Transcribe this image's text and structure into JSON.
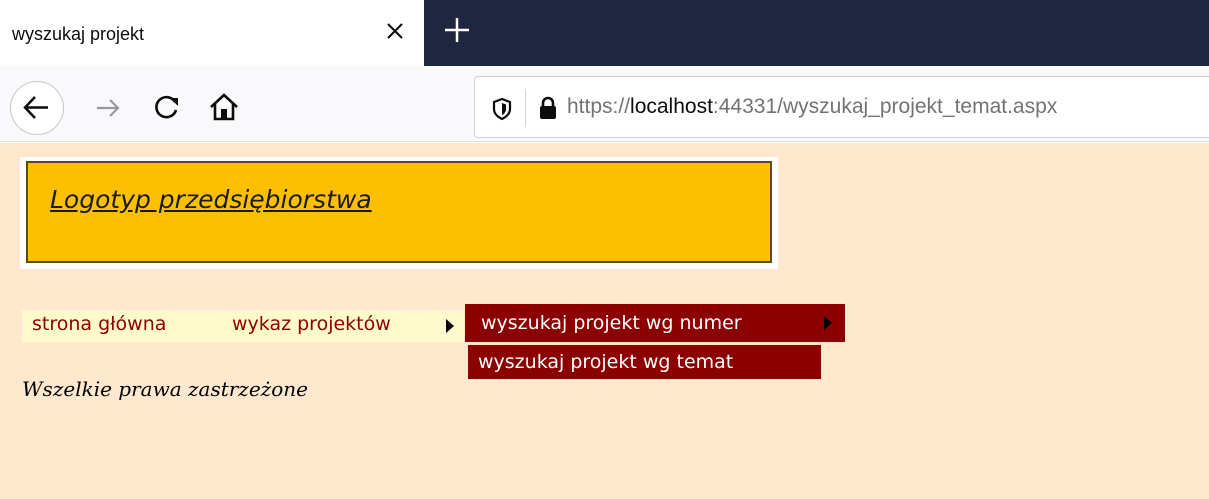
{
  "browser": {
    "tab_title": "wyszukaj projekt",
    "url_prefix": "https://",
    "url_host": "localhost",
    "url_rest": ":44331/wyszukaj_projekt_temat.aspx"
  },
  "page": {
    "logo_text": "Logotyp przedsiębiorstwa",
    "menu": {
      "home": "strona główna",
      "projects": "wykaz projektów",
      "search_by_number": "wyszukaj projekt wg numer",
      "search_by_topic": "wyszukaj projekt wg temat"
    },
    "footer": "Wszelkie prawa zastrzeżone"
  },
  "colors": {
    "tabstrip": "#1f2640",
    "page_background": "#ffe8cd",
    "logo_box": "#fcc000",
    "menu_bar": "#fffacd",
    "menu_text": "#8b0000",
    "dropdown": "#8b0000"
  },
  "icons": [
    "close-icon",
    "plus-icon",
    "back-arrow-icon",
    "forward-arrow-icon",
    "reload-icon",
    "home-icon",
    "shield-icon",
    "lock-icon",
    "submenu-arrow-icon"
  ]
}
